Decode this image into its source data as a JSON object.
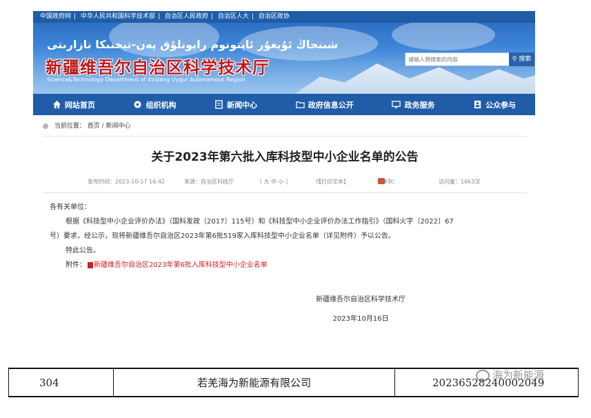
{
  "topbar": {
    "links": [
      "中国政府网",
      "中华人民共和国科学技术部",
      "自治区人民政府",
      "自治区人大",
      "自治区政协"
    ]
  },
  "banner": {
    "uyghur_name": "شىنجاڭ ئۇيغۇر ئاپتونوم رايونلۇق پەن-تېخنىكا نازارىتى",
    "cn_name": "新疆维吾尔自治区科学技术厅",
    "en_name": "Science&Technology Department of Xinjiang Uygur Autonomous Region"
  },
  "search": {
    "placeholder": "请输入想搜索的内容",
    "button": "搜索"
  },
  "nav": {
    "items": [
      {
        "label": "网站首页",
        "icon": "home-icon"
      },
      {
        "label": "组织机构",
        "icon": "org-icon"
      },
      {
        "label": "新闻中心",
        "icon": "news-icon"
      },
      {
        "label": "政府信息公开",
        "icon": "folder-icon"
      },
      {
        "label": "政务服务",
        "icon": "service-icon"
      },
      {
        "label": "公众参与",
        "icon": "participate-icon"
      }
    ]
  },
  "breadcrumb": {
    "label": "当前位置：",
    "path": "首页 / 新闻中心"
  },
  "article": {
    "title": "关于2023年第六批入库科技型中小企业名单的公告",
    "meta": {
      "published": "发布时间：2023-10-17 16:42",
      "source": "来源：自治区科技厅",
      "font_size": "［ 大  中  小 ］",
      "print": "【打印文本】",
      "share": "分享到：",
      "visits": "访问量：1663次"
    },
    "salutation": "各有关单位：",
    "body1": "根据《科技型中小企业评价办法》（国科发政〔2017〕115号）和《科技型中小企业评价办法工作指引》（国科火字〔2022〕67",
    "body2": "号）要求，经公示，现将新疆维吾尔自治区2023年第6批519家入库科技型中小企业名单（详见附件）予以公告。",
    "closing": "特此公告。",
    "attachment_label": "附件：",
    "attachment_link": "新疆维吾尔自治区2023年第6批入库科技型中小企业名单",
    "signature_org": "新疆维吾尔自治区科学技术厅",
    "signature_date": "2023年10月16日"
  },
  "table_row": {
    "index": "304",
    "company": "若羌海为新能源有限公司",
    "code": "20236528240002049"
  },
  "watermark": {
    "text": "海为新能源"
  },
  "colors": {
    "nav_blue": "#1f5da8",
    "title_red": "#c01a1a",
    "link_red": "#d21d1d"
  }
}
